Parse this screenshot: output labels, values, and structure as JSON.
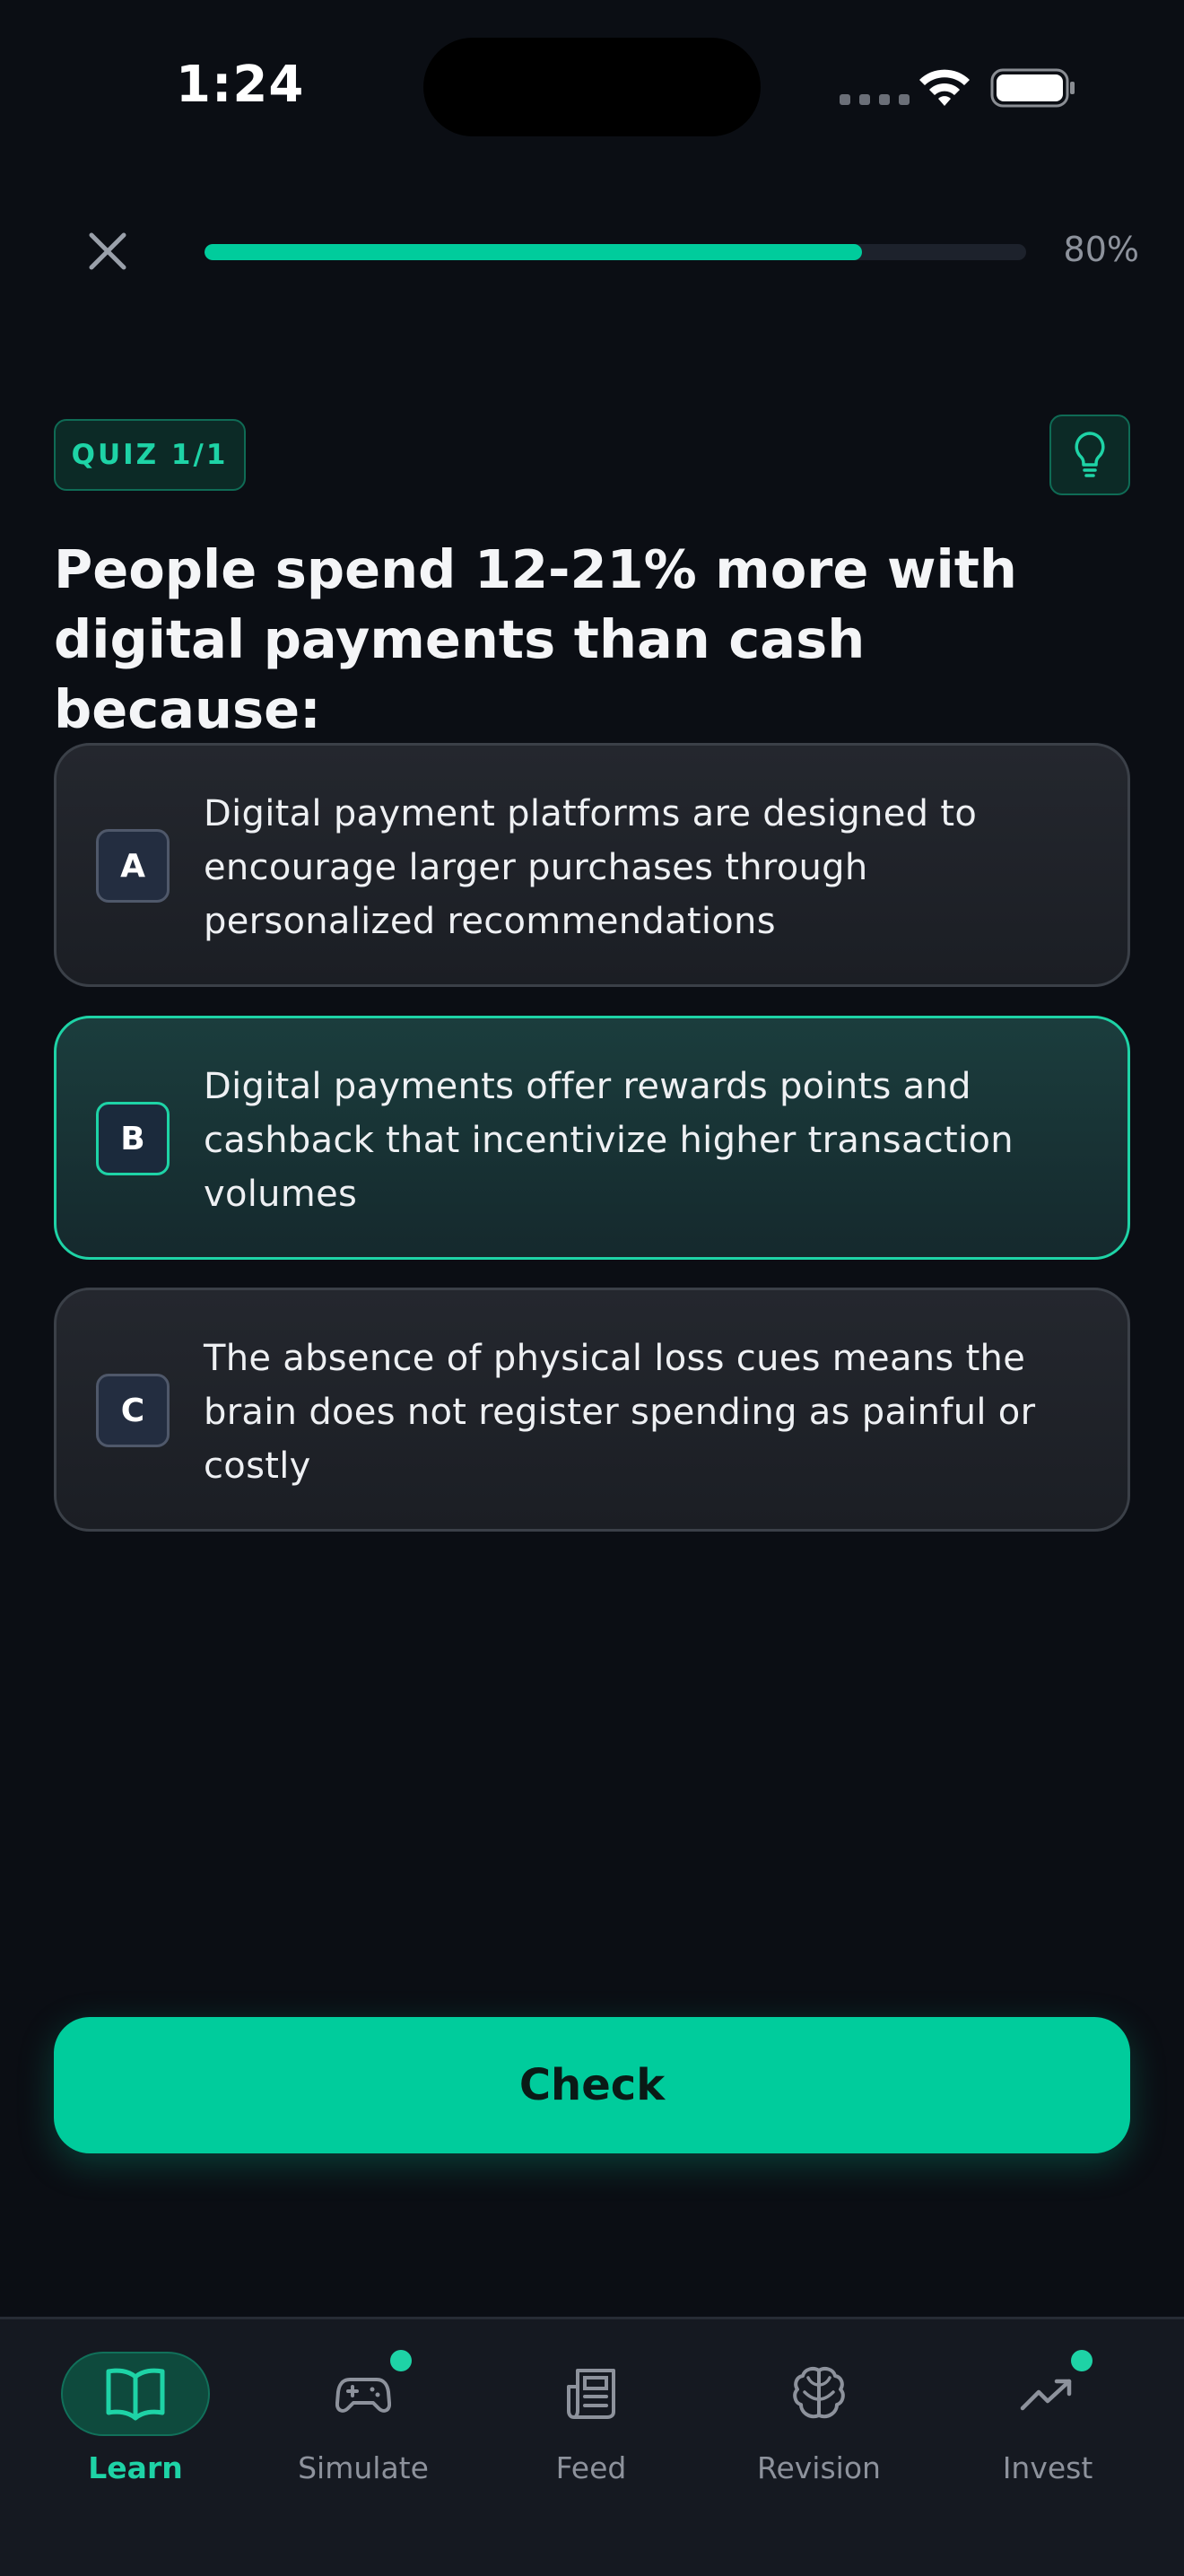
{
  "status_bar": {
    "time": "1:24"
  },
  "progress": {
    "percent_label": "80%",
    "value": 0.8
  },
  "quiz": {
    "badge": "QUIZ 1/1",
    "question": "People spend 12-21% more with digital payments than cash because:",
    "options": [
      {
        "letter": "A",
        "text": "Digital payment platforms are designed to encourage larger purchases through personalized recommendations",
        "selected": false
      },
      {
        "letter": "B",
        "text": "Digital payments offer rewards points and cashback that incentivize higher transaction volumes",
        "selected": true
      },
      {
        "letter": "C",
        "text": "The absence of physical loss cues means the brain does not register spending as painful or costly",
        "selected": false
      }
    ]
  },
  "actions": {
    "check_label": "Check"
  },
  "nav": {
    "items": [
      {
        "label": "Learn",
        "icon": "book-open-icon",
        "active": true,
        "dot": false
      },
      {
        "label": "Simulate",
        "icon": "gamepad-icon",
        "active": false,
        "dot": true
      },
      {
        "label": "Feed",
        "icon": "newspaper-icon",
        "active": false,
        "dot": false
      },
      {
        "label": "Revision",
        "icon": "brain-icon",
        "active": false,
        "dot": false
      },
      {
        "label": "Invest",
        "icon": "trending-up-icon",
        "active": false,
        "dot": true
      }
    ]
  },
  "colors": {
    "background": "#0b0e14",
    "accent": "#00cc9c",
    "accent_text": "#1ed3a6",
    "card": "#1f2228",
    "muted_text": "#8d929c"
  }
}
